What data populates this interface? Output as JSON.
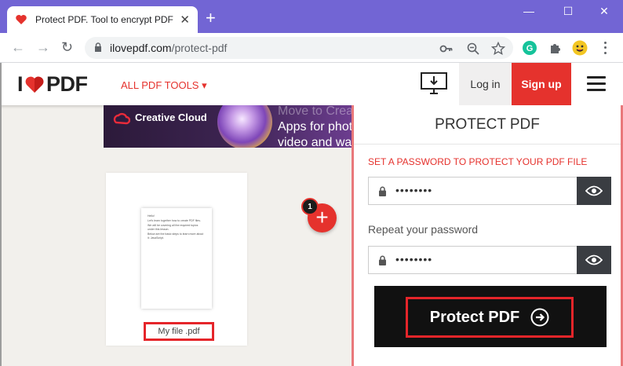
{
  "browser": {
    "tab_title": "Protect PDF. Tool to encrypt PDF",
    "tab_close": "✕",
    "new_tab": "+",
    "url_domain": "ilovepdf.com",
    "url_path": "/protect-pdf"
  },
  "header": {
    "logo_left": "I",
    "logo_right": "PDF",
    "all_tools": "ALL PDF TOOLS ▾",
    "login": "Log in",
    "signup": "Sign up"
  },
  "ad": {
    "brand": "Creative Cloud",
    "lines": [
      "Move to Crea",
      "Apps for phot",
      "video and wa"
    ]
  },
  "file": {
    "name": "My file .pdf",
    "preview_lines": [
      "Hello!",
      "Let's learn together how to create PDF files.",
      "We will be covering all the required topics under this lesson.",
      "Below are the basic steps to learn more about it: JavaScript."
    ]
  },
  "add_badge": "1",
  "panel": {
    "title": "PROTECT PDF",
    "subtitle": "SET A PASSWORD TO PROTECT YOUR PDF FILE",
    "password_mask": "••••••••",
    "repeat_label": "Repeat your password",
    "repeat_mask": "••••••••",
    "button_label": "Protect PDF"
  },
  "colors": {
    "brand": "#e5322d",
    "chrome": "#7265d4",
    "dark": "#111111"
  }
}
